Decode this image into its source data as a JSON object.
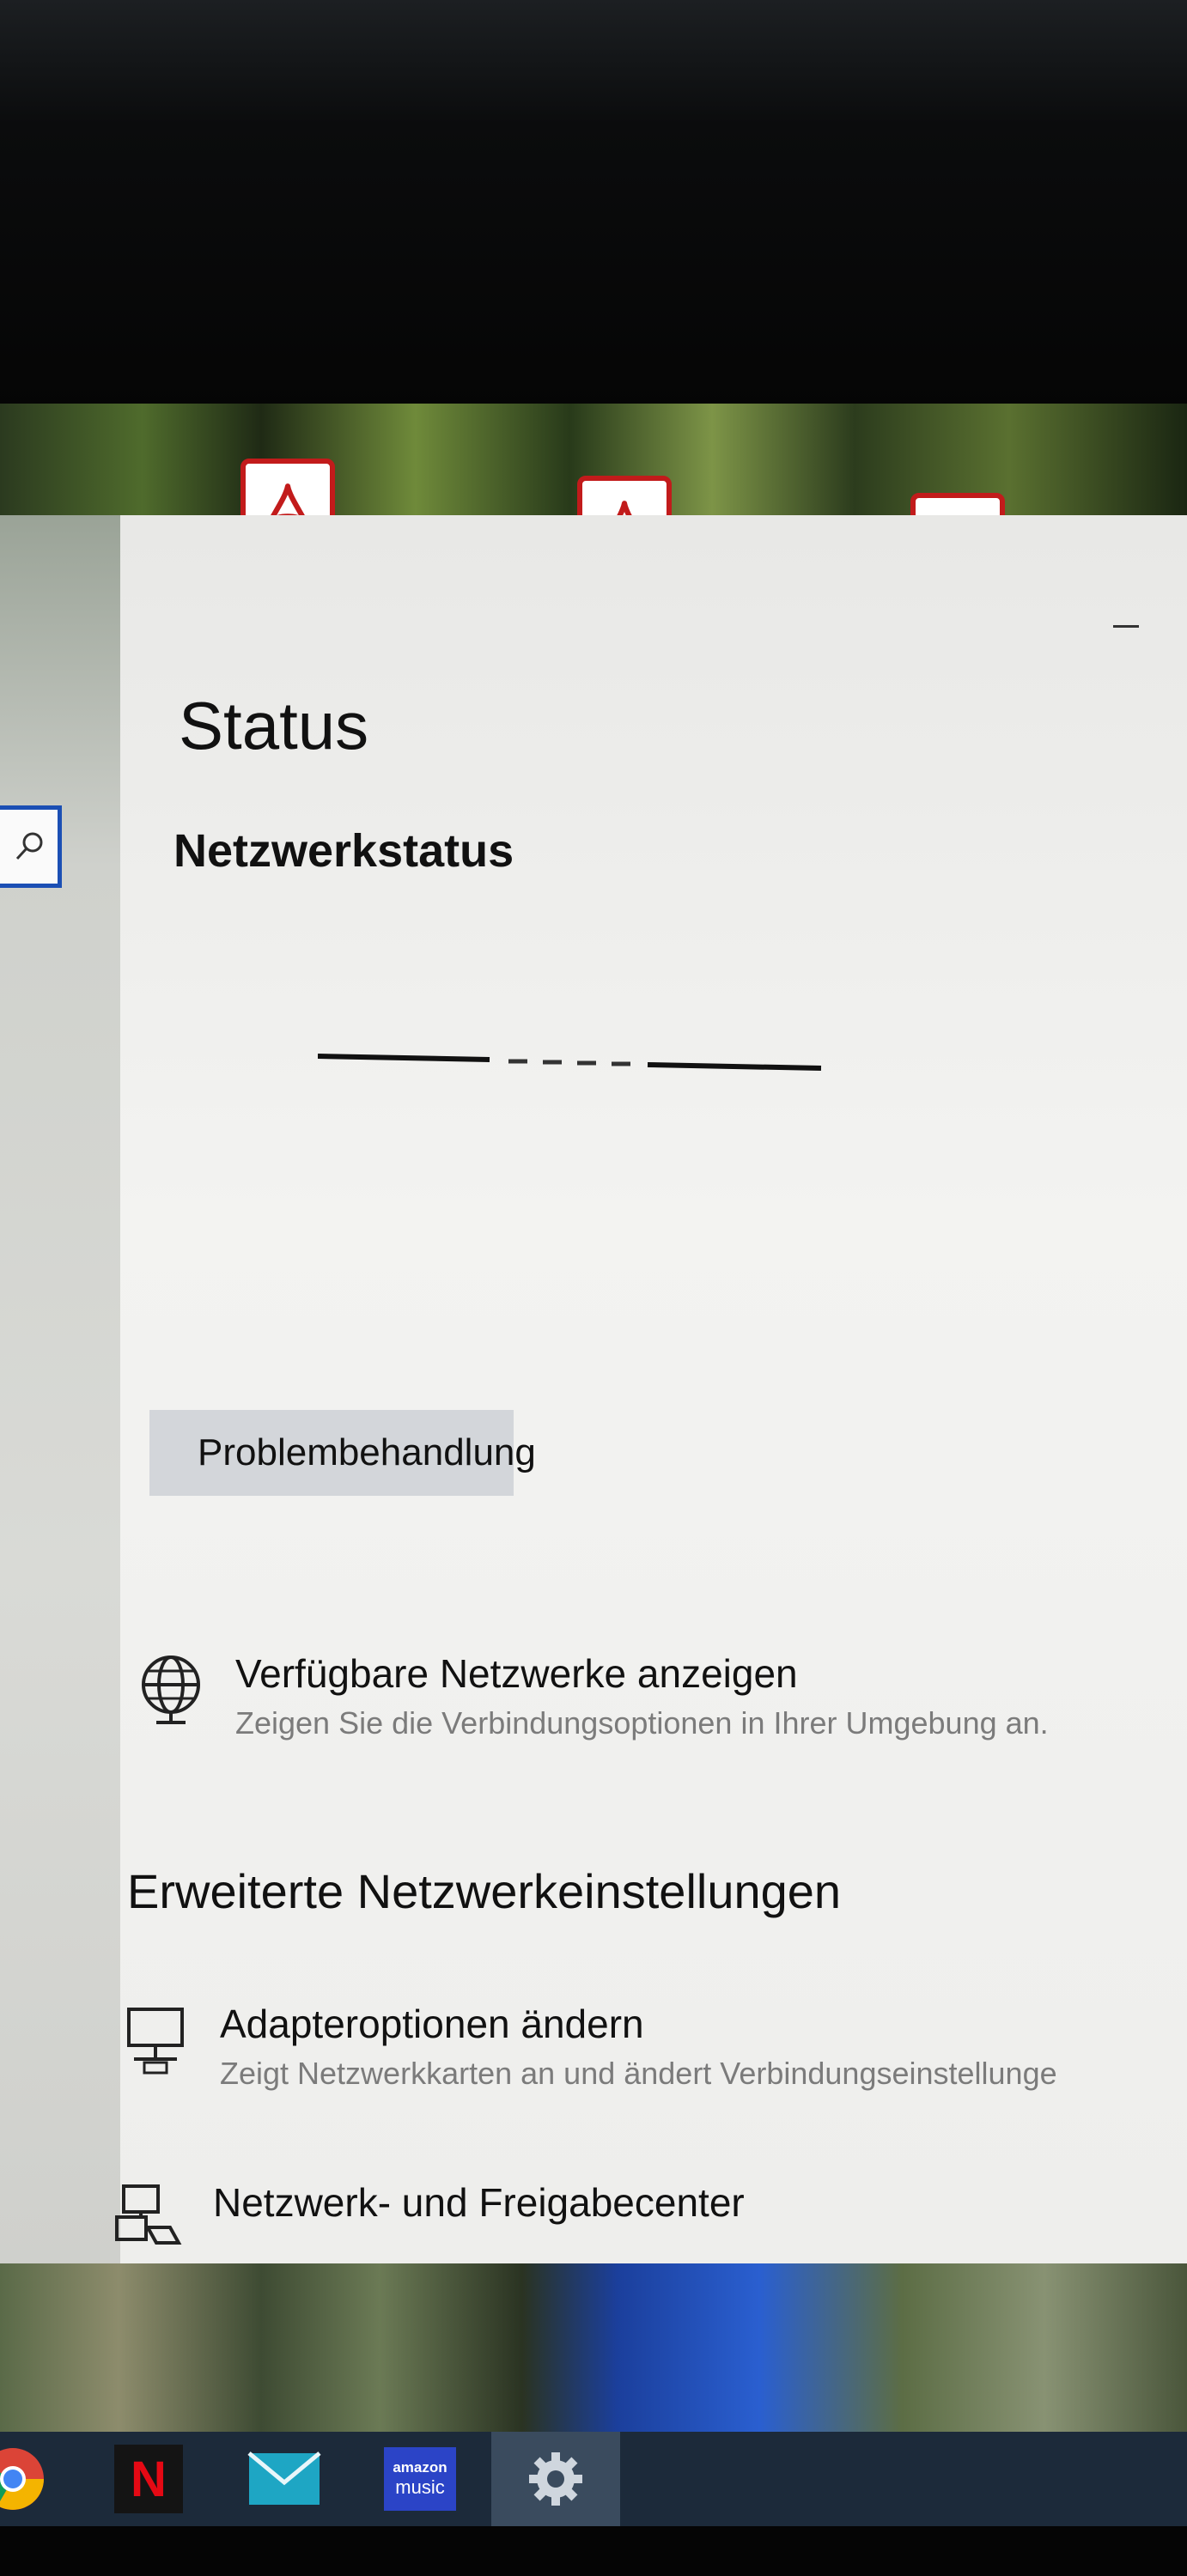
{
  "window": {
    "page_title": "Status",
    "section_title": "Netzwerkstatus"
  },
  "troubleshoot": {
    "label": "Problembehandlung",
    "icon": "warning-triangle-icon"
  },
  "available_networks": {
    "title": "Verfügbare Netzwerke anzeigen",
    "subtitle": "Zeigen Sie die Verbindungsoptionen in Ihrer Umgebung an.",
    "icon": "globe-network-icon"
  },
  "advanced": {
    "heading": "Erweiterte Netzwerkeinstellungen",
    "items": [
      {
        "title": "Adapteroptionen ändern",
        "subtitle": "Zeigt Netzwerkkarten an und ändert Verbindungseinstellunge",
        "icon": "network-adapter-icon"
      },
      {
        "title": "Netzwerk- und Freigabecenter",
        "subtitle": "",
        "icon": "sharing-center-icon"
      }
    ]
  },
  "taskbar": {
    "apps": [
      {
        "name": "Chrome",
        "icon": "chrome-icon"
      },
      {
        "name": "Netflix",
        "icon": "netflix-icon",
        "glyph": "N"
      },
      {
        "name": "Mail",
        "icon": "mail-icon"
      },
      {
        "name": "Amazon Music",
        "icon": "amazon-music-icon",
        "line1": "amazon",
        "line2": "music"
      },
      {
        "name": "Einstellungen",
        "icon": "settings-gear-icon"
      }
    ]
  },
  "colors": {
    "accent": "#1b4fb4",
    "pdf_red": "#c21b1b",
    "taskbar": "#1c2a3a"
  }
}
